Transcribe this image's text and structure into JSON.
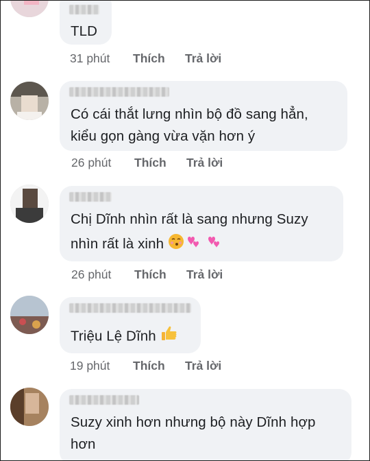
{
  "comments": [
    {
      "text_lines": [
        "TLD"
      ],
      "time": "31 phút",
      "like": "Thích",
      "reply": "Trả lời"
    },
    {
      "text_lines": [
        "Có cái thắt lưng nhìn bộ đồ sang hẳn,",
        "kiểu gọn gàng vừa vặn hơn ý"
      ],
      "time": "26 phút",
      "like": "Thích",
      "reply": "Trả lời"
    },
    {
      "text_lines": [
        "Chị Dĩnh nhìn rất là sang nhưng Suzy",
        "nhìn rất là xinh"
      ],
      "emojis": [
        "kissing-face-emoji",
        "two-hearts-emoji",
        "two-hearts-emoji"
      ],
      "time": "26 phút",
      "like": "Thích",
      "reply": "Trả lời"
    },
    {
      "text_lines": [
        "Triệu Lệ Dĩnh"
      ],
      "emojis": [
        "thumbs-up-emoji"
      ],
      "time": "19 phút",
      "like": "Thích",
      "reply": "Trả lời"
    },
    {
      "text_lines": [
        "Suzy xinh hơn nhưng bộ này Dĩnh hợp",
        "hơn"
      ]
    }
  ],
  "colors": {
    "bubble": "#f0f2f5",
    "meta": "#65676b",
    "text": "#1c1e21"
  }
}
